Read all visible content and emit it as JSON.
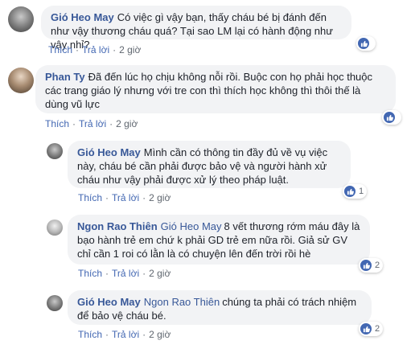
{
  "colors": {
    "link": "#385898",
    "bubble": "#f2f3f5",
    "like": "#4267b2"
  },
  "action_labels": {
    "like": "Thích",
    "reply": "Trả lời"
  },
  "comments": [
    {
      "author": "Gió Heo May",
      "mention": "",
      "text": "Có việc gì vậy bạn, thấy cháu bé bị đánh đến như vậy thương cháu quá? Tại sao LM lại có hành động như vậy nhỉ?",
      "time": "2 giờ",
      "reactions": {
        "icon": "like-icon",
        "count": ""
      }
    },
    {
      "author": "Phan Ty",
      "mention": "",
      "text": "Đã đến lúc họ chịu không nỗi rồi. Buộc con họ phải học thuộc các trang giáo lý nhưng với tre con thì thích học không thì thôi thế là dùng vũ lực",
      "time": "2 giờ",
      "reactions": {
        "icon": "like-icon",
        "count": ""
      }
    },
    {
      "author": "Gió Heo May",
      "mention": "",
      "text": "Mình cần có thông tin đầy đủ về vụ việc này, cháu bé cần phải được bảo vệ và người hành xử cháu như vậy phải được xử lý theo pháp luật.",
      "time": "2 giờ",
      "reactions": {
        "icon": "like-icon",
        "count": "1"
      }
    },
    {
      "author": "Ngon Rao Thiên",
      "mention": "Gió Heo May",
      "text": "8 vết thương rớm máu đây là bạo hành trẻ em chứ k phải GD trẻ em nữa rồi. Giả sử GV chỉ cần 1 roi có lằn là có chuyện lên đến trời rồi hè",
      "time": "2 giờ",
      "reactions": {
        "icon": "like-icon",
        "count": "2"
      }
    },
    {
      "author": "Gió Heo May",
      "mention": "Ngon Rao Thiên",
      "text": "chúng ta phải có trách nhiệm để bảo vệ cháu bé.",
      "time": "2 giờ",
      "reactions": {
        "icon": "like-icon",
        "count": "2"
      }
    }
  ]
}
